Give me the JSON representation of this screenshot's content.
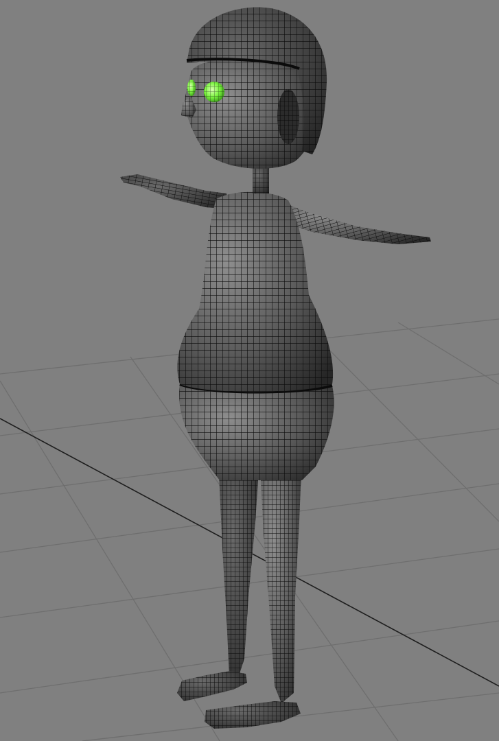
{
  "viewport": {
    "background_color": "#808080",
    "grid_line_color": "#6e6e6e",
    "grid_axis_color": "#1e1e1e",
    "mesh_base_color": "#3a3a3a",
    "mesh_highlight_color": "#8e8e8e",
    "mesh_wire_color": "#0b0b0b",
    "selection_color": "#7df542",
    "view_mode": "wireframe-on-shaded"
  },
  "model": {
    "pose": "T-pose",
    "parts": [
      "head",
      "hair",
      "ear",
      "eyes",
      "nose",
      "neck",
      "torso",
      "arms",
      "hips",
      "legs",
      "feet"
    ],
    "eyes_selected": true
  }
}
